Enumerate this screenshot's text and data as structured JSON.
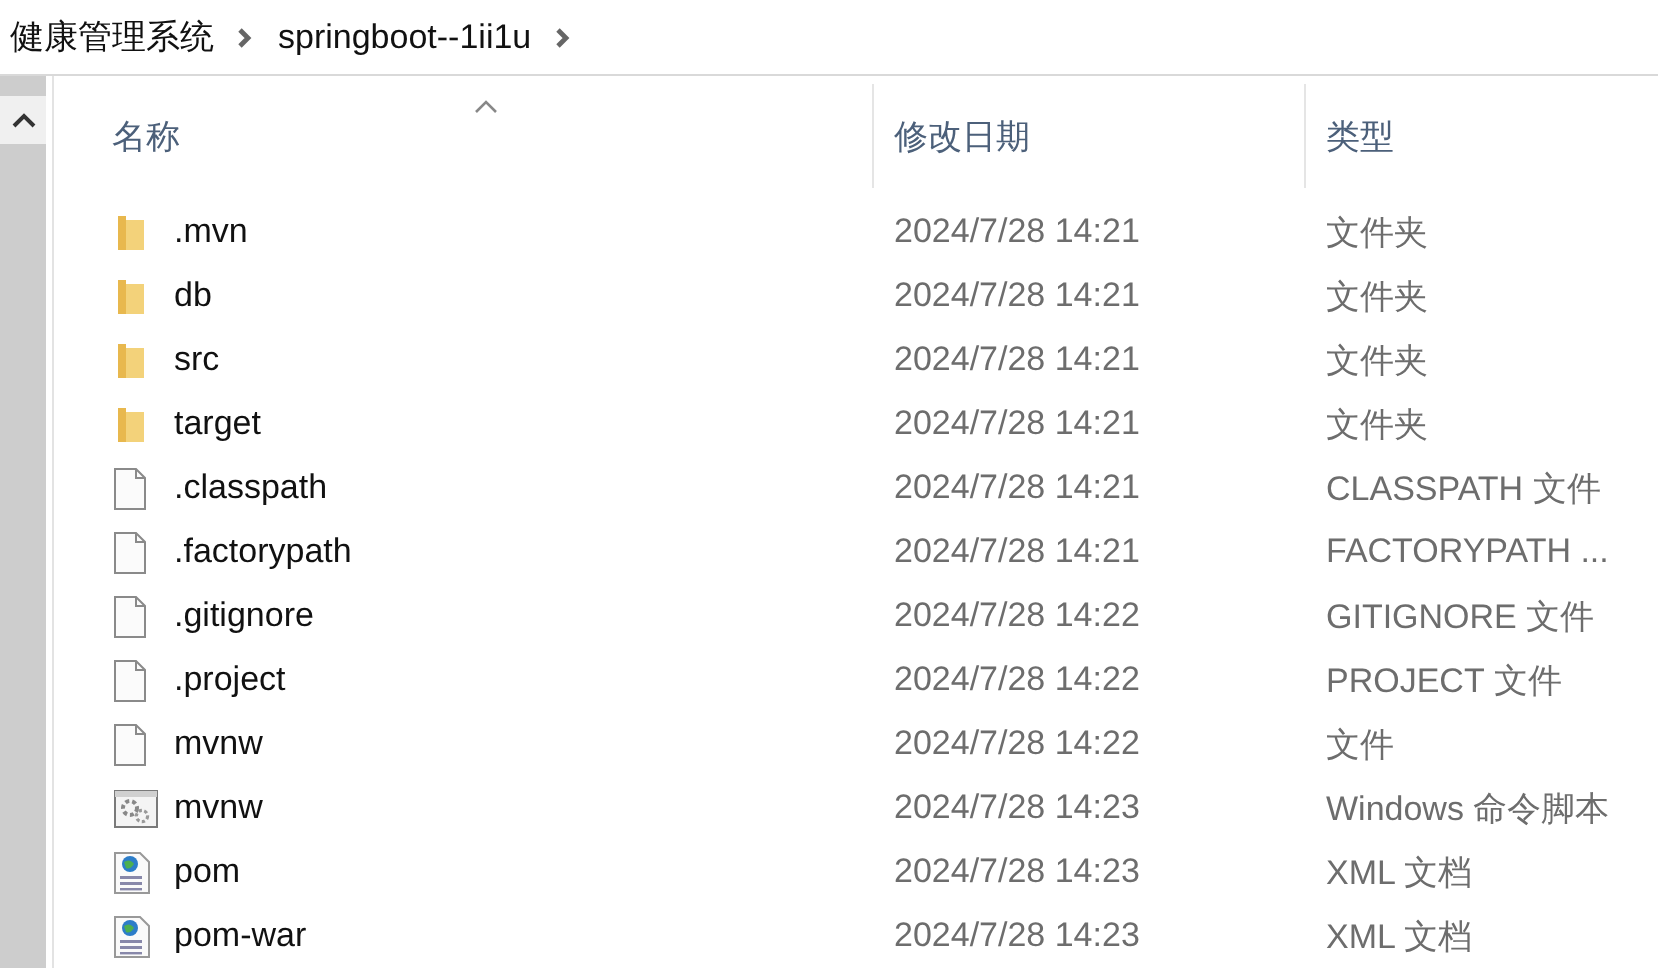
{
  "breadcrumb": [
    "健康管理系统",
    "springboot--1ii1u"
  ],
  "columns": [
    {
      "label": "名称",
      "sorted": true
    },
    {
      "label": "修改日期",
      "sorted": false
    },
    {
      "label": "类型",
      "sorted": false
    }
  ],
  "rows": [
    {
      "kind": "folder",
      "name": ".mvn",
      "date": "2024/7/28 14:21",
      "type": "文件夹"
    },
    {
      "kind": "folder",
      "name": "db",
      "date": "2024/7/28 14:21",
      "type": "文件夹"
    },
    {
      "kind": "folder",
      "name": "src",
      "date": "2024/7/28 14:21",
      "type": "文件夹"
    },
    {
      "kind": "folder",
      "name": "target",
      "date": "2024/7/28 14:21",
      "type": "文件夹"
    },
    {
      "kind": "file",
      "name": ".classpath",
      "date": "2024/7/28 14:21",
      "type": "CLASSPATH 文件"
    },
    {
      "kind": "file",
      "name": ".factorypath",
      "date": "2024/7/28 14:21",
      "type": "FACTORYPATH ..."
    },
    {
      "kind": "file",
      "name": ".gitignore",
      "date": "2024/7/28 14:22",
      "type": "GITIGNORE 文件"
    },
    {
      "kind": "file",
      "name": ".project",
      "date": "2024/7/28 14:22",
      "type": "PROJECT 文件"
    },
    {
      "kind": "file",
      "name": "mvnw",
      "date": "2024/7/28 14:22",
      "type": "文件"
    },
    {
      "kind": "script",
      "name": "mvnw",
      "date": "2024/7/28 14:23",
      "type": "Windows 命令脚本"
    },
    {
      "kind": "xml",
      "name": "pom",
      "date": "2024/7/28 14:23",
      "type": "XML 文档"
    },
    {
      "kind": "xml",
      "name": "pom-war",
      "date": "2024/7/28 14:23",
      "type": "XML 文档"
    }
  ]
}
